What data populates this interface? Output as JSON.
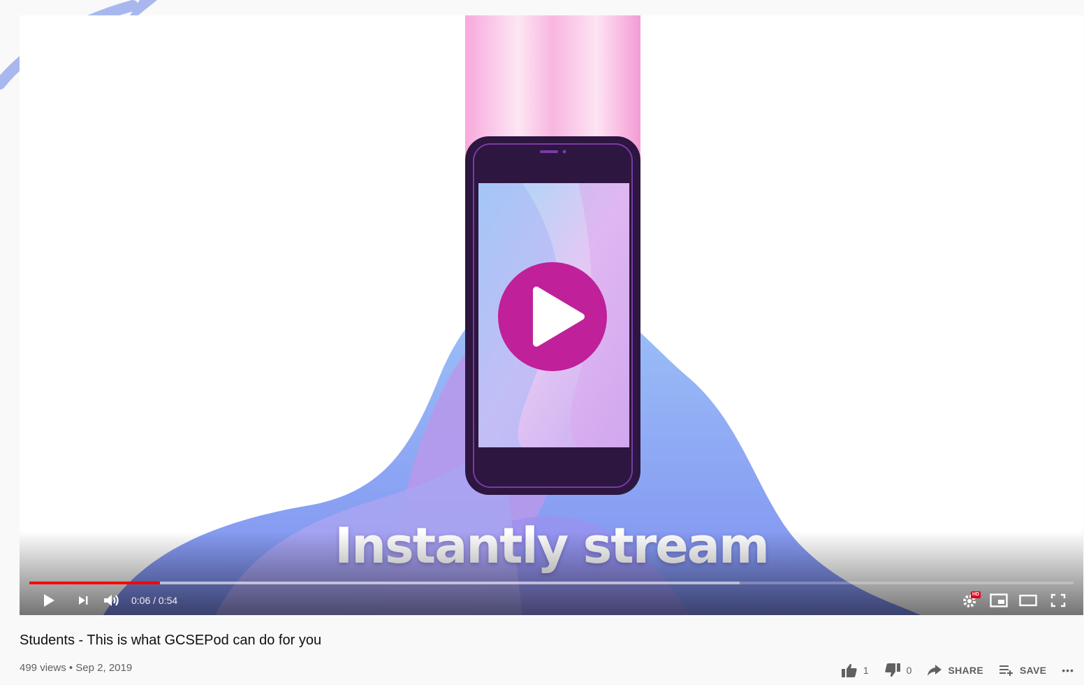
{
  "video": {
    "caption": "Instantly stream",
    "current_time": "0:06",
    "duration": "0:54",
    "time_separator": " / ",
    "progress_played_fraction": 0.125,
    "progress_buffered_fraction": 0.68,
    "hd_badge": "HD"
  },
  "info": {
    "title": "Students - This is what GCSEPod can do for you",
    "meta": "499 views • Sep 2, 2019"
  },
  "actions": {
    "like_count": "1",
    "dislike_count": "0",
    "share_label": "SHARE",
    "save_label": "SAVE",
    "more_label": "•••"
  },
  "colors": {
    "progress": "#ff0000",
    "play_circle": "#c0209a",
    "phone_frame": "#2d1640",
    "background": "#f9f9f9"
  }
}
